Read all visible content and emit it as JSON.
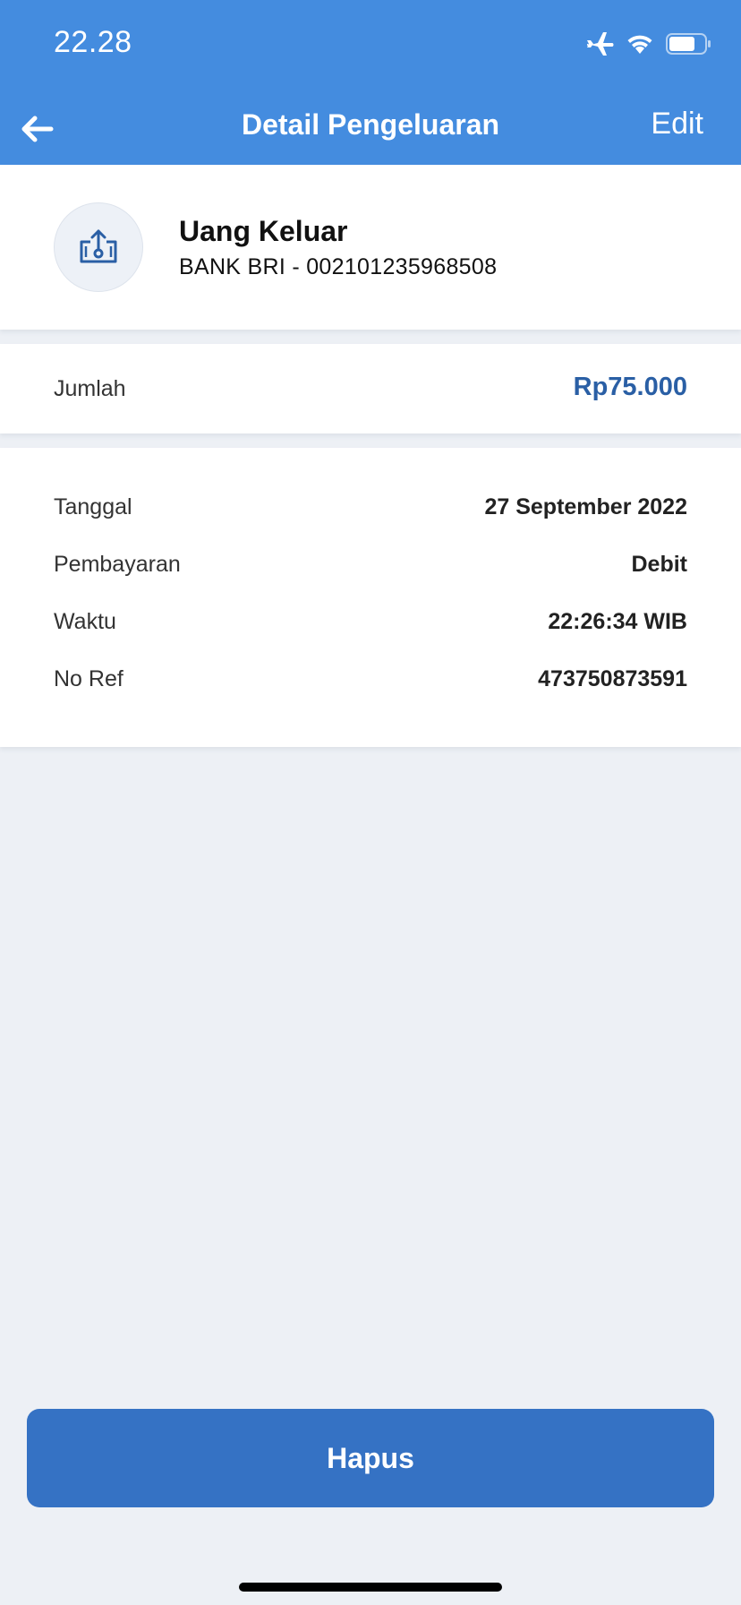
{
  "status_bar": {
    "time": "22.28",
    "icons": [
      "airplane-icon",
      "wifi-icon",
      "battery-icon"
    ]
  },
  "header": {
    "title": "Detail Pengeluaran",
    "back_icon": "arrow-left-icon",
    "edit_label": "Edit",
    "color": "#448cdf"
  },
  "account": {
    "icon": "money-out-icon",
    "title": "Uang Keluar",
    "subtitle": "BANK BRI - 002101235968508"
  },
  "amount": {
    "label": "Jumlah",
    "value": "Rp75.000",
    "color": "#2a5fa5"
  },
  "details": [
    {
      "label": "Tanggal",
      "value": "27 September 2022"
    },
    {
      "label": "Pembayaran",
      "value": "Debit"
    },
    {
      "label": "Waktu",
      "value": "22:26:34 WIB"
    },
    {
      "label": "No Ref",
      "value": "473750873591"
    }
  ],
  "actions": {
    "delete_label": "Hapus",
    "delete_color": "#3572c4"
  }
}
